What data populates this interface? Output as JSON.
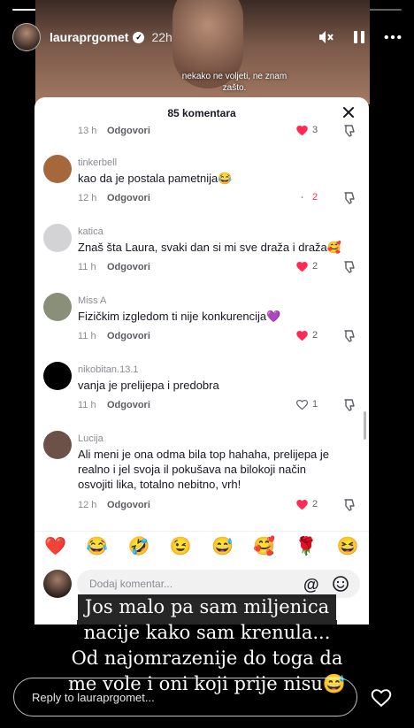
{
  "story": {
    "segments": [
      true,
      true,
      true,
      true,
      false,
      false
    ],
    "username": "lauraprgomet",
    "verified_mark": "✓",
    "time": "22h",
    "caption": "nekako ne voljeti, ne znam zašto.",
    "icons": [
      "mute-icon",
      "pause-icon",
      "more-icon"
    ]
  },
  "comments_panel": {
    "title": "85 komentara",
    "reply_label": "Odgovori",
    "top_partial": {
      "time": "13 h",
      "likes": "3"
    },
    "comments": [
      {
        "user": "tinkerbell",
        "text": "kao da je postala pametnija😂",
        "time": "12 h",
        "likes": "2",
        "liked": false,
        "avatar": "#a5673c"
      },
      {
        "user": "katica",
        "text": "Znaš šta Laura, svaki dan si mi sve draža i draža🥰",
        "time": "11 h",
        "likes": "2",
        "liked": true,
        "avatar": "#d3d3d6"
      },
      {
        "user": "Miss A",
        "text": "Fizičkim izgledom ti nije konkurencija💜",
        "time": "11 h",
        "likes": "2",
        "liked": true,
        "avatar": "#8a8f7a"
      },
      {
        "user": "nikobitan.13.1",
        "text": "vanja je prelijepa i predobra",
        "time": "11 h",
        "likes": "1",
        "liked": false,
        "avatar": "#000000"
      },
      {
        "user": "Lucija",
        "text": "Ali meni je ona odma bila top hahaha, prelijepa je realno i jel svoja il pokušava na bilokoji način osvojiti lika, totalno nebitno, vrh!",
        "time": "12 h",
        "likes": "2",
        "liked": true,
        "avatar": "#6b5148"
      }
    ],
    "emojis": [
      "❤️",
      "😂",
      "🤣",
      "😉",
      "😅",
      "🥰",
      "🌹",
      "😆"
    ],
    "composer_placeholder": "Dodaj komentar...",
    "at_symbol": "@"
  },
  "overlay_caption": [
    "Jos malo pa sam miljenica",
    "nacije kako sam krenula...",
    "Od najomrazenije do toga da",
    "me vole i oni koji prije nisu😅"
  ],
  "reply_bar": {
    "placeholder": "Reply to lauraprgomet..."
  },
  "colors": {
    "like_red": "#fe2c55",
    "text_dark": "#161823",
    "muted": "#8a8b91"
  }
}
